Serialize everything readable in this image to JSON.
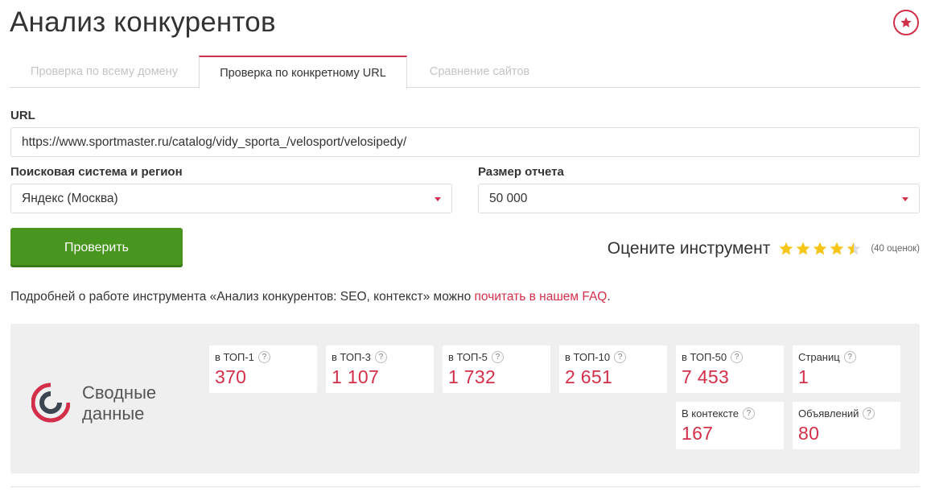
{
  "page": {
    "title": "Анализ конкурентов"
  },
  "tabs": [
    {
      "label": "Проверка по всему домену",
      "active": false
    },
    {
      "label": "Проверка по конкретному URL",
      "active": true
    },
    {
      "label": "Сравнение сайтов",
      "active": false
    }
  ],
  "form": {
    "url_label": "URL",
    "url_value": "https://www.sportmaster.ru/catalog/vidy_sporta_/velosport/velosipedy/",
    "engine_label": "Поисковая система и регион",
    "engine_value": "Яндекс (Москва)",
    "size_label": "Размер отчета",
    "size_value": "50 000",
    "submit_label": "Проверить"
  },
  "rating": {
    "title": "Оцените инструмент",
    "stars": 4.5,
    "max_stars": 5,
    "count_text": "(40 оценок)"
  },
  "info": {
    "text": "Подробней о работе инструмента «Анализ конкурентов: SEO, контекст» можно ",
    "link": "почитать в нашем FAQ",
    "suffix": "."
  },
  "summary": {
    "title_line1": "Сводные",
    "title_line2": "данные",
    "help_glyph": "?",
    "cards": [
      {
        "label": "в ТОП-1",
        "value": "370"
      },
      {
        "label": "в ТОП-3",
        "value": "1 107"
      },
      {
        "label": "в ТОП-5",
        "value": "1 732"
      },
      {
        "label": "в ТОП-10",
        "value": "2 651"
      },
      {
        "label": "в ТОП-50",
        "value": "7 453"
      },
      {
        "label": "Страниц",
        "value": "1"
      },
      {
        "label": "В контексте",
        "value": "167"
      },
      {
        "label": "Объявлений",
        "value": "80"
      }
    ]
  },
  "colors": {
    "accent": "#d32f4a",
    "button": "#48961f",
    "star": "#f5c518",
    "panel": "#efefef"
  },
  "icons": {
    "favorite": "star-circle-icon",
    "dropdown": "caret-down-icon",
    "help": "question-circle-icon",
    "summary": "ring-logo-icon"
  }
}
